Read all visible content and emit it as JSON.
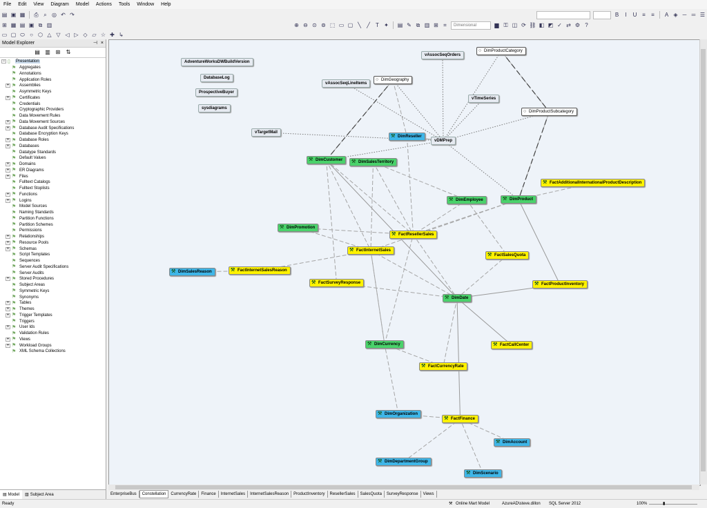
{
  "menu": [
    "File",
    "Edit",
    "View",
    "Diagram",
    "Model",
    "Actions",
    "Tools",
    "Window",
    "Help"
  ],
  "toolbar": {
    "notation": "Dimensional"
  },
  "explorer": {
    "title": "Model Explorer",
    "root": "Presentation",
    "items": [
      "Aggregates",
      "Annotations",
      "Application Roles",
      "Assemblies",
      "Asymmetric Keys",
      "Certificates",
      "Credentials",
      "Cryptographic Providers",
      "Data Movement Rules",
      "Data Movement Sources",
      "Database Audit Specifications",
      "Database Encryption Keys",
      "Database Roles",
      "Databases",
      "Datatype Standards",
      "Default Values",
      "Domains",
      "ER Diagrams",
      "Files",
      "Fulltext Catalogs",
      "Fulltext Stoplists",
      "Functions",
      "Logins",
      "Model Sources",
      "Naming Standards",
      "Partition Functions",
      "Partition Schemes",
      "Permissions",
      "Relationships",
      "Resource Pools",
      "Schemas",
      "Script Templates",
      "Sequences",
      "Server Audit Specifications",
      "Server Audits",
      "Stored Procedures",
      "Subject Areas",
      "Symmetric Keys",
      "Synonyms",
      "Tables",
      "Themes",
      "Trigger Templates",
      "Triggers",
      "User Ids",
      "Validation Rules",
      "Views",
      "Workload Groups",
      "XML Schema Collections"
    ],
    "tabs": [
      "Model",
      "Subject Area"
    ]
  },
  "diagram": {
    "entities": [
      {
        "name": "AdventureWorksDWBuildVersion",
        "kind": "view"
      },
      {
        "name": "DatabaseLog",
        "kind": "view"
      },
      {
        "name": "ProspectiveBuyer",
        "kind": "view"
      },
      {
        "name": "sysdiagrams",
        "kind": "view"
      },
      {
        "name": "vTargetMail",
        "kind": "view"
      },
      {
        "name": "vAssocSeqLineItems",
        "kind": "view"
      },
      {
        "name": "DimGeography",
        "kind": "outline"
      },
      {
        "name": "vAssocSeqOrders",
        "kind": "view"
      },
      {
        "name": "DimProductCategory",
        "kind": "outline"
      },
      {
        "name": "vTimeSeries",
        "kind": "view"
      },
      {
        "name": "DimProductSubcategory",
        "kind": "outline"
      },
      {
        "name": "DimReseller",
        "kind": "blue"
      },
      {
        "name": "vDMPrep",
        "kind": "view"
      },
      {
        "name": "DimCustomer",
        "kind": "dim"
      },
      {
        "name": "DimSalesTerritory",
        "kind": "dim"
      },
      {
        "name": "FactAdditionalInternationalProductDescription",
        "kind": "fact"
      },
      {
        "name": "DimEmployee",
        "kind": "dim"
      },
      {
        "name": "DimProduct",
        "kind": "dim"
      },
      {
        "name": "DimPromotion",
        "kind": "dim"
      },
      {
        "name": "FactResellerSales",
        "kind": "fact"
      },
      {
        "name": "FactInternetSales",
        "kind": "fact"
      },
      {
        "name": "FactSalesQuota",
        "kind": "fact"
      },
      {
        "name": "DimSalesReason",
        "kind": "blue"
      },
      {
        "name": "FactInternetSalesReason",
        "kind": "fact"
      },
      {
        "name": "FactSurveyResponse",
        "kind": "fact"
      },
      {
        "name": "FactProductInventory",
        "kind": "fact"
      },
      {
        "name": "DimDate",
        "kind": "dim"
      },
      {
        "name": "DimCurrency",
        "kind": "dim"
      },
      {
        "name": "FactCallCenter",
        "kind": "fact"
      },
      {
        "name": "FactCurrencyRate",
        "kind": "fact"
      },
      {
        "name": "DimOrganization",
        "kind": "blue"
      },
      {
        "name": "FactFinance",
        "kind": "fact"
      },
      {
        "name": "DimAccount",
        "kind": "blue"
      },
      {
        "name": "DimDepartmentGroup",
        "kind": "blue"
      },
      {
        "name": "DimScenario",
        "kind": "blue"
      }
    ],
    "tabs": [
      "EnterpriseBus",
      "Constellation",
      "CurrencyRate",
      "Finance",
      "InternetSales",
      "InternetSalesReason",
      "ProductInventory",
      "ResellerSales",
      "SalesQuota",
      "SurveyResponse",
      "Views"
    ],
    "active_tab": "Constellation"
  },
  "status": {
    "ready": "Ready",
    "model": "Online Mart Model",
    "user": "AzureAD\\steve.dillon",
    "server": "SQL Server 2012",
    "zoom": "100%"
  }
}
